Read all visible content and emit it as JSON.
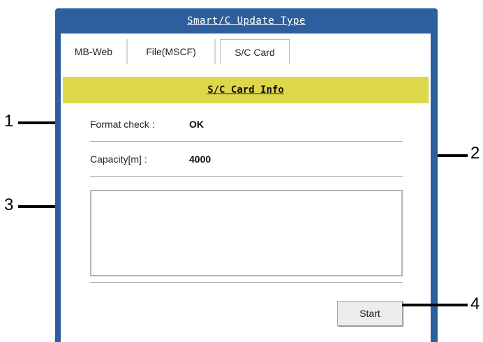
{
  "window": {
    "title": "Smart/C Update Type"
  },
  "tabs": [
    {
      "label": "MB-Web",
      "active": false
    },
    {
      "label": "File(MSCF)",
      "active": false
    },
    {
      "label": "S/C Card",
      "active": true
    }
  ],
  "card_info": {
    "header": "S/C Card Info",
    "format_check_label": "Format check :",
    "format_check_value": "OK",
    "capacity_label": "Capacity[m] :",
    "capacity_value": "4000",
    "log_text": ""
  },
  "actions": {
    "start_label": "Start"
  },
  "callouts": [
    "1",
    "2",
    "3",
    "4"
  ],
  "colors": {
    "frame": "#2d5f9e",
    "header_bar": "#ddd84a",
    "background": "#ffffff"
  }
}
